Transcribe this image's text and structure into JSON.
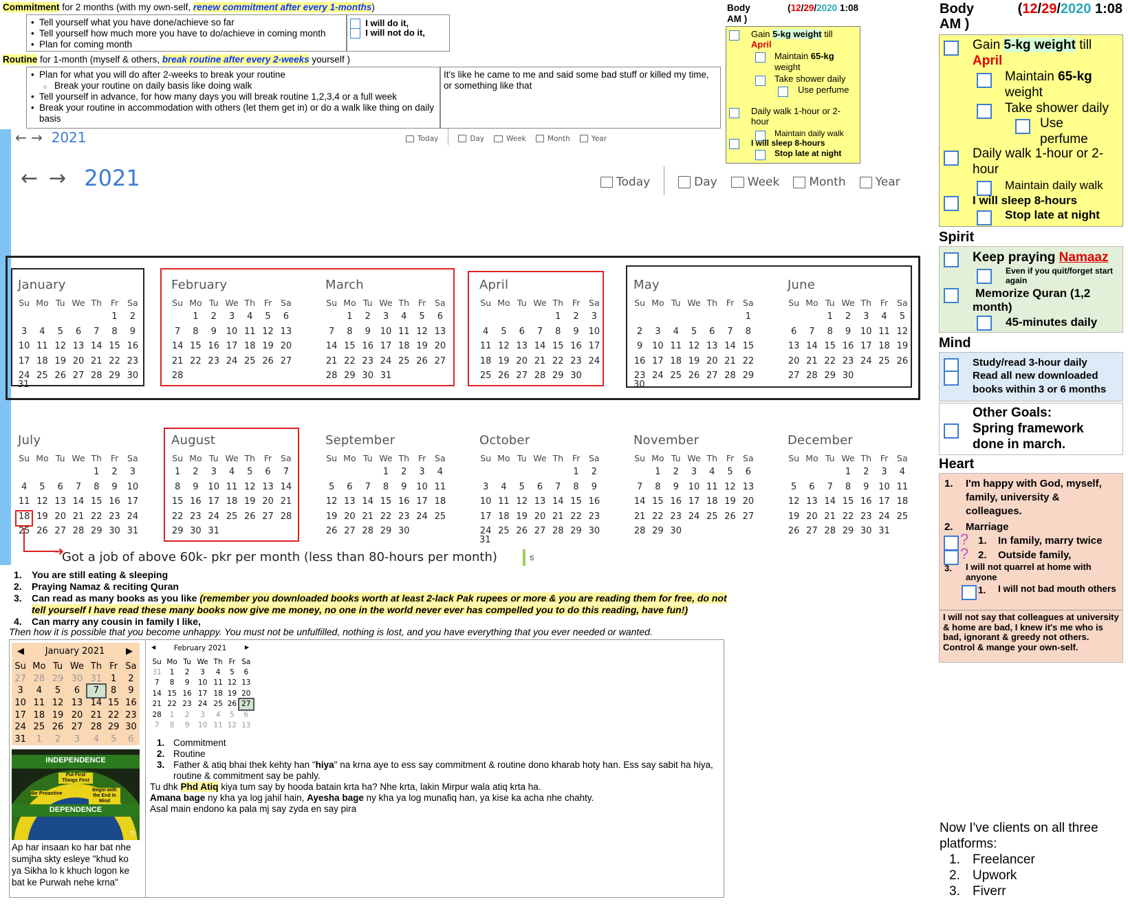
{
  "commitment": {
    "label": "Commitment",
    "text": " for 2 months (with my own-self, ",
    "emph": "renew commitment after every 1-months",
    "close": ")",
    "bullets": [
      "Tell yourself what you have done/achieve so far",
      "Tell yourself how much more you have to do/achieve in coming month",
      "Plan for coming month"
    ],
    "will": "I will do it,",
    "willnot": "I will not do it,"
  },
  "routine": {
    "label": "Routine",
    "text": " for 1-month (myself & others, ",
    "emph": "break routine after every 2-weeks",
    "close": " yourself )",
    "bullets": [
      "Plan for what you will do after 2-weeks to break your routine",
      "Tell yourself in advance, for how many days you will break routine 1,2,3,4 or a full week",
      "Break your routine in accommodation with others (let them get in) or do a walk like thing on daily basis"
    ],
    "sub": "Break your routine on  daily basis like doing walk",
    "note": "It's like he came to me and said some bad stuff or killed my time, or something like that"
  },
  "body_small": {
    "title": "Body AM )",
    "date_m": "12",
    "date_d": "29",
    "date_y": "2020",
    "time": "1:08",
    "i1a": "Gain ",
    "i1b": "5-kg weight",
    "i1c": " till",
    "i1d": "April",
    "i2a": "Maintain ",
    "i2b": "65-kg",
    "i2c": " weight",
    "i3": "Take shower daily",
    "i4": "Use perfume",
    "i5": "Daily walk 1-hour or 2-hour",
    "i6": "Maintain daily walk",
    "i7": "I will sleep 8-hours",
    "i8": "Stop late at night"
  },
  "calendar": {
    "year": "2021",
    "views": [
      "Today",
      "Day",
      "Week",
      "Month",
      "Year"
    ],
    "weekdays": [
      "Su",
      "Mo",
      "Tu",
      "We",
      "Th",
      "Fr",
      "Sa"
    ],
    "months": [
      {
        "name": "January",
        "start": 5,
        "days": 31
      },
      {
        "name": "February",
        "start": 1,
        "days": 28
      },
      {
        "name": "March",
        "start": 1,
        "days": 31
      },
      {
        "name": "April",
        "start": 4,
        "days": 30
      },
      {
        "name": "May",
        "start": 6,
        "days": 31
      },
      {
        "name": "June",
        "start": 2,
        "days": 30
      },
      {
        "name": "July",
        "start": 4,
        "days": 31
      },
      {
        "name": "August",
        "start": 0,
        "days": 31
      },
      {
        "name": "September",
        "start": 3,
        "days": 30
      },
      {
        "name": "October",
        "start": 5,
        "days": 31
      },
      {
        "name": "November",
        "start": 1,
        "days": 30
      },
      {
        "name": "December",
        "start": 3,
        "days": 31
      }
    ],
    "job_note": "Got a job of above 60k- pkr per month (less than 80-hours per month)",
    "s_mark": "s"
  },
  "gratitude": {
    "items": [
      {
        "num": "1.",
        "text": "You are still eating & sleeping"
      },
      {
        "num": "2.",
        "text": "Praying Namaz & reciting Quran"
      },
      {
        "num": "3.",
        "text": "Can read as many books as you like ",
        "emph": "(remember you downloaded books worth at least 2-lack Pak rupees or more & you are reading them for free, do not tell yourself I have read these many books now give me money, no one in the world never ever has compelled you to do this reading, have fun!)"
      },
      {
        "num": "4.",
        "text": "Can marry any cousin in family I like,"
      }
    ],
    "footer": "Then how it is possible that you become unhappy. You must not be unfulfilled, nothing is lost, and you have everything that you ever needed or wanted."
  },
  "mini_jan": {
    "title": "January 2021",
    "rows": [
      [
        "27",
        "28",
        "29",
        "30",
        "31",
        "1",
        "2"
      ],
      [
        "3",
        "4",
        "5",
        "6",
        "7",
        "8",
        "9"
      ],
      [
        "10",
        "11",
        "12",
        "13",
        "14",
        "15",
        "16"
      ],
      [
        "17",
        "18",
        "19",
        "20",
        "21",
        "22",
        "23"
      ],
      [
        "24",
        "25",
        "26",
        "27",
        "28",
        "29",
        "30"
      ],
      [
        "31",
        "1",
        "2",
        "3",
        "4",
        "5",
        "6"
      ]
    ]
  },
  "mini_feb": {
    "title": "February 2021",
    "rows": [
      [
        "31",
        "1",
        "2",
        "3",
        "4",
        "5",
        "6"
      ],
      [
        "7",
        "8",
        "9",
        "10",
        "11",
        "12",
        "13"
      ],
      [
        "14",
        "15",
        "16",
        "17",
        "18",
        "19",
        "20"
      ],
      [
        "21",
        "22",
        "23",
        "24",
        "25",
        "26",
        "27"
      ],
      [
        "28",
        "1",
        "2",
        "3",
        "4",
        "5",
        "6"
      ],
      [
        "7",
        "8",
        "9",
        "10",
        "11",
        "12",
        "13"
      ]
    ]
  },
  "poster": {
    "top": "INDEPENDENCE",
    "mid": "Put First Things First",
    "left": "Be Proactive",
    "right": "Begin with the End In Mind",
    "bottom": "DEPENDENCE",
    "tag": "TI"
  },
  "urdu_caption": "Ap har insaan ko har bat nhe sumjha skty esleye \"khud ko ya Sikha lo k khuch logon ke bat ke Purwah nehe krna\"",
  "notes": {
    "list": [
      "Commitment",
      "Routine"
    ],
    "n3a": "Father & atiq bhai thek kehty han \"",
    "n3b": "hiya",
    "n3c": "\" na krna aye to ess say commitment & routine dono kharab hoty han. Ess say sabit ha hiya, routine & commitment say be pahly.",
    "l1a": "Tu dhk ",
    "l1b": "Phd Atiq",
    "l1c": " kiya tum say by hooda batain krta ha? Nhe krta, lakin Mirpur wala atiq krta ha.",
    "l2a": "Amana bage",
    "l2b": " ny kha ya log jahil hain, ",
    "l2c": "Ayesha bage",
    "l2d": " ny kha ya log munafiq han, ya kise ka acha nhe chahty.",
    "l3": "Asal main endono ka pala mj say zyda en say pira"
  },
  "right": {
    "body_title": "Body",
    "body_title2": "AM )",
    "date_m": "12",
    "date_d": "29",
    "date_y": "2020",
    "time": "1:08",
    "b1a": "Gain ",
    "b1b": "5-kg weight",
    "b1c": " till",
    "b1d": "April",
    "b2a": "Maintain ",
    "b2b": "65-kg",
    "b2c": "weight",
    "b3": "Take shower daily",
    "b4a": "Use",
    "b4b": "perfume",
    "b5a": "Daily walk 1-hour or 2-",
    "b5b": "hour",
    "b6": "Maintain daily walk",
    "b7": "I will sleep 8-hours",
    "b8": "Stop late at night",
    "spirit": "Spirit",
    "s1a": "Keep praying ",
    "s1b": "Namaaz",
    "s1c": "Even if you quit/forget start again",
    "s2a": "Memorize Quran (1,2",
    "s2b": "month)",
    "s3": "45-minutes daily",
    "mind": "Mind",
    "m1": "Study/read 3-hour daily",
    "m2a": "Read all new downloaded",
    "m2b": "books within 3 or 6 months",
    "og1": "Other Goals:",
    "og2": "Spring framework",
    "og3": "done in march.",
    "heart": "Heart",
    "h1": "I'm happy with God, myself, family, university & colleagues.",
    "h2": "Marriage",
    "h2a": "In family, marry twice",
    "h2b": "Outside family,",
    "h3": "I will not quarrel at home with anyone",
    "h3a": "I will not bad mouth others",
    "h_note": "I will not say that colleagues at university & home are bad, I knew it's me who is bad, ignorant & greedy not others. Control & mange your own-self.",
    "clients_title": "Now I've clients on all three platforms:",
    "clients": [
      "Freelancer",
      "Upwork",
      "Fiverr"
    ]
  }
}
